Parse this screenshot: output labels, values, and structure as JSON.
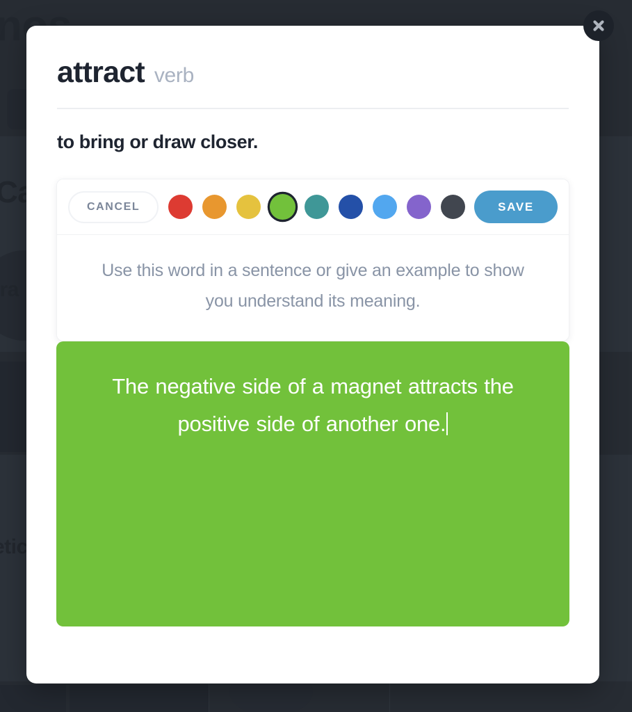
{
  "backdrop": {
    "ghost_texts": [
      {
        "text": "nos",
        "position": "logo"
      },
      {
        "text": "Car",
        "position": "card1"
      },
      {
        "text": "tra",
        "position": "card2"
      },
      {
        "text": "etic",
        "position": "card3"
      }
    ],
    "overlay_color": "#2c323a"
  },
  "modal": {
    "close_icon": "close-icon",
    "word": "attract",
    "part_of_speech": "verb",
    "definition": "to bring or draw closer.",
    "toolbar": {
      "cancel_label": "CANCEL",
      "save_label": "SAVE",
      "save_color": "#4a9ccc",
      "selected_color_index": 3,
      "colors": [
        {
          "name": "red",
          "hex": "#dd3b32"
        },
        {
          "name": "orange",
          "hex": "#e8972f"
        },
        {
          "name": "yellow",
          "hex": "#e5c23e"
        },
        {
          "name": "green",
          "hex": "#72c13b"
        },
        {
          "name": "teal",
          "hex": "#3f9797"
        },
        {
          "name": "dark-blue",
          "hex": "#2450a8"
        },
        {
          "name": "light-blue",
          "hex": "#52a7ef"
        },
        {
          "name": "purple",
          "hex": "#8464cc"
        },
        {
          "name": "charcoal",
          "hex": "#41464f"
        }
      ]
    },
    "prompt": "Use this word in a sentence or give an example to show you understand its meaning.",
    "answer": {
      "text": "The negative side of a magnet attracts the positive side of another one.",
      "background": "#72c13b",
      "caret_visible": true
    }
  }
}
